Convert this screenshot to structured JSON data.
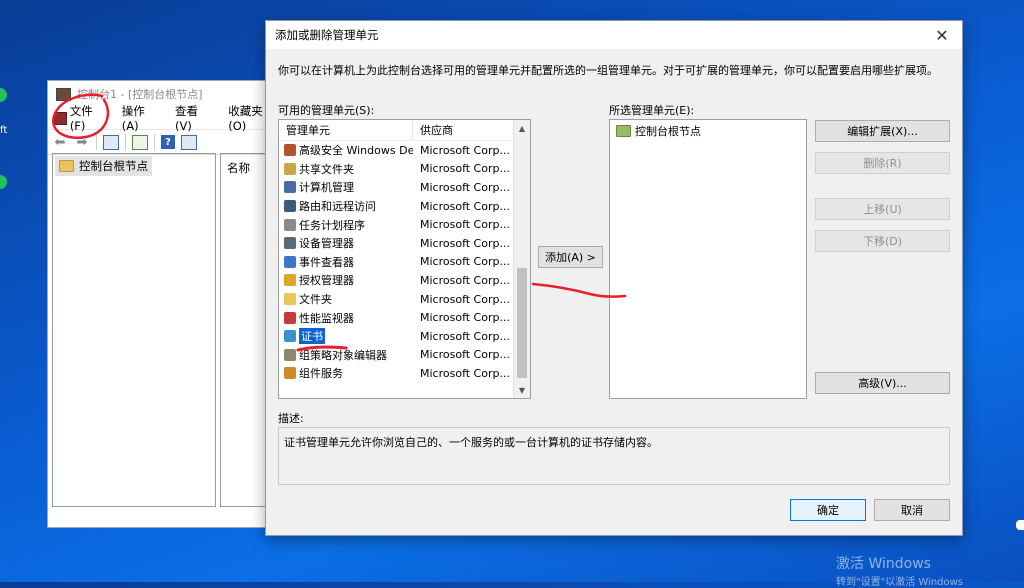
{
  "desktop": {
    "side_text": "ft",
    "watermark_line1": "激活 Windows",
    "watermark_line2": "转到\"设置\"以激活 Windows"
  },
  "console": {
    "title": "控制台1 - [控制台根节点]",
    "menu": [
      "文件(F)",
      "操作(A)",
      "查看(V)",
      "收藏夹(O)"
    ],
    "tree_root": "控制台根节点",
    "column_name": "名称"
  },
  "dialog": {
    "title": "添加或删除管理单元",
    "close_glyph": "✕",
    "intro": "你可以在计算机上为此控制台选择可用的管理单元并配置所选的一组管理单元。对于可扩展的管理单元，你可以配置要启用哪些扩展项。",
    "available_label": "可用的管理单元(S):",
    "selected_label": "所选管理单元(E):",
    "columns": {
      "snapin": "管理单元",
      "vendor": "供应商"
    },
    "snapins": [
      {
        "name": "高级安全 Windows Def...",
        "vendor": "Microsoft Corp...",
        "icon": "firewall-icon",
        "color": "#b0562a"
      },
      {
        "name": "共享文件夹",
        "vendor": "Microsoft Corp...",
        "icon": "shared-folder-icon",
        "color": "#c9a64a"
      },
      {
        "name": "计算机管理",
        "vendor": "Microsoft Corp...",
        "icon": "computer-mgmt-icon",
        "color": "#4a6aa8"
      },
      {
        "name": "路由和远程访问",
        "vendor": "Microsoft Corp...",
        "icon": "routing-icon",
        "color": "#3a5a7a"
      },
      {
        "name": "任务计划程序",
        "vendor": "Microsoft Corp...",
        "icon": "clock-icon",
        "color": "#8a8a8a"
      },
      {
        "name": "设备管理器",
        "vendor": "Microsoft Corp...",
        "icon": "device-manager-icon",
        "color": "#5a6a7a"
      },
      {
        "name": "事件查看器",
        "vendor": "Microsoft Corp...",
        "icon": "event-viewer-icon",
        "color": "#3d78c8"
      },
      {
        "name": "授权管理器",
        "vendor": "Microsoft Corp...",
        "icon": "authorization-icon",
        "color": "#d9a82a"
      },
      {
        "name": "文件夹",
        "vendor": "Microsoft Corp...",
        "icon": "folder-icon",
        "color": "#e8c65a"
      },
      {
        "name": "性能监视器",
        "vendor": "Microsoft Corp...",
        "icon": "performance-icon",
        "color": "#c83a3a"
      },
      {
        "name": "证书",
        "vendor": "Microsoft Corp...",
        "icon": "certificate-icon",
        "color": "#3d8fd0",
        "selected": true
      },
      {
        "name": "组策略对象编辑器",
        "vendor": "Microsoft Corp...",
        "icon": "group-policy-icon",
        "color": "#8a8a6a"
      },
      {
        "name": "组件服务",
        "vendor": "Microsoft Corp...",
        "icon": "component-services-icon",
        "color": "#d08a2a"
      }
    ],
    "add_button": "添加(A) >",
    "selected_items": [
      "控制台根节点"
    ],
    "side_buttons": {
      "edit_extensions": "编辑扩展(X)...",
      "remove": "删除(R)",
      "move_up": "上移(U)",
      "move_down": "下移(D)",
      "advanced": "高级(V)..."
    },
    "description_label": "描述:",
    "description": "证书管理单元允许你浏览自己的、一个服务的或一台计算机的证书存储内容。",
    "ok": "确定",
    "cancel": "取消"
  },
  "colors": {
    "desktop": "#0a5bd0",
    "selection": "#0a64d6",
    "annotation": "#e8202a"
  }
}
